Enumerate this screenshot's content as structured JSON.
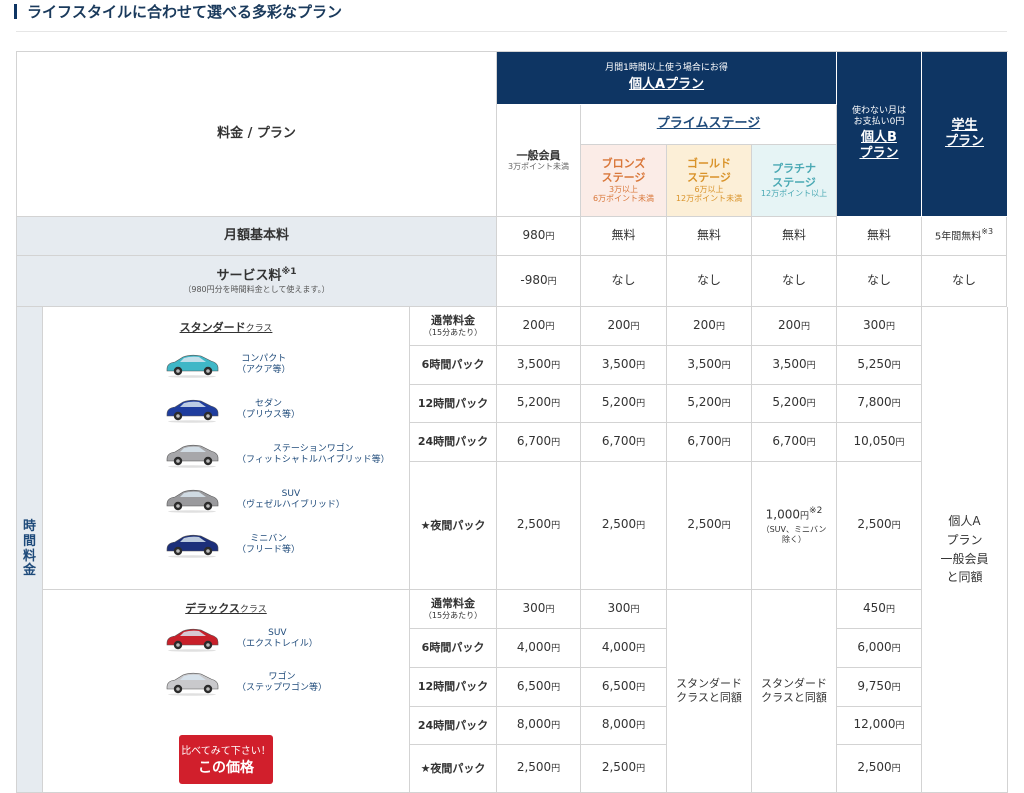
{
  "section": {
    "title": "ライフスタイルに合わせて選べる多彩なプラン"
  },
  "header": {
    "corner_label": "料金 / プラン",
    "planA_note": "月間1時間以上使う場合にお得",
    "planA_name": "個人Aプラン",
    "prime_stage": "プライムステージ",
    "general_member": "一般会員",
    "general_member_sub": "3万ポイント未満",
    "bronze": "ブロンズ\nステージ",
    "bronze_sub": "3万以上\n6万ポイント未満",
    "gold": "ゴールド\nステージ",
    "gold_sub": "6万以上\n12万ポイント未満",
    "platinum": "プラチナ\nステージ",
    "platinum_sub": "12万ポイント以上",
    "planB_note": "使わない月は\nお支払い0円",
    "planB_name": "個人B\nプラン",
    "student_name": "学生\nプラン"
  },
  "monthly": {
    "label": "月額基本料",
    "values": [
      "980",
      "無料",
      "無料",
      "無料",
      "無料",
      "5年間無料"
    ],
    "value_units": [
      "円",
      "",
      "",
      "",
      "",
      ""
    ],
    "student_note": "※3"
  },
  "service": {
    "label": "サービス料",
    "label_note": "※1",
    "sub": "（980円分を時間料金として使えます。）",
    "values": [
      "-980",
      "なし",
      "なし",
      "なし",
      "なし",
      "なし"
    ],
    "value_units": [
      "円",
      "",
      "",
      "",
      "",
      ""
    ]
  },
  "time_fee": {
    "label": "時\n間\n料\n金"
  },
  "yen": "円",
  "standard": {
    "class_name": "スタンダード",
    "class_suffix": "クラス",
    "cars": [
      {
        "name": "コンパクト",
        "example": "（アクア等）",
        "color": "#3fb7c7"
      },
      {
        "name": "セダン",
        "example": "（プリウス等）",
        "color": "#1f3d9e"
      },
      {
        "name": "ステーションワゴン",
        "example": "（フィットシャトルハイブリッド等）",
        "color": "#a7a7aa"
      },
      {
        "name": "SUV",
        "example": "（ヴェゼルハイブリッド）",
        "color": "#9a9a9d"
      },
      {
        "name": "ミニバン",
        "example": "（フリード等）",
        "color": "#1c2f7a"
      }
    ],
    "rows": [
      {
        "label": "通常料金",
        "sub": "（15分あたり）",
        "values": [
          "200",
          "200",
          "200",
          "200",
          "300"
        ]
      },
      {
        "label": "6時間パック",
        "values": [
          "3,500",
          "3,500",
          "3,500",
          "3,500",
          "5,250"
        ]
      },
      {
        "label": "12時間パック",
        "values": [
          "5,200",
          "5,200",
          "5,200",
          "5,200",
          "7,800"
        ]
      },
      {
        "label": "24時間パック",
        "values": [
          "6,700",
          "6,700",
          "6,700",
          "6,700",
          "10,050"
        ]
      },
      {
        "label": "★夜間パック",
        "values": [
          "2,500",
          "2,500",
          "2,500",
          "1,000",
          "2,500"
        ]
      }
    ],
    "night_platinum_note": "※2",
    "night_platinum_sub": "（SUV、ミニバン\n除く）"
  },
  "deluxe": {
    "class_name": "デラックス",
    "class_suffix": "クラス",
    "cars": [
      {
        "name": "SUV",
        "example": "（エクストレイル）",
        "color": "#c8202a"
      },
      {
        "name": "ワゴン",
        "example": "（ステップワゴン等）",
        "color": "#c9c9cc"
      }
    ],
    "rows": [
      {
        "label": "通常料金",
        "sub": "（15分あたり）",
        "values": [
          "300",
          "300",
          "450"
        ]
      },
      {
        "label": "6時間パック",
        "values": [
          "4,000",
          "4,000",
          "6,000"
        ]
      },
      {
        "label": "12時間パック",
        "values": [
          "6,500",
          "6,500",
          "9,750"
        ]
      },
      {
        "label": "24時間パック",
        "values": [
          "8,000",
          "8,000",
          "12,000"
        ]
      },
      {
        "label": "★夜間パック",
        "values": [
          "2,500",
          "2,500",
          "2,500"
        ]
      }
    ],
    "same_as_standard": "スタンダード\nクラスと同額",
    "cta_line1": "比べてみて下さい！",
    "cta_line2": "この価格"
  },
  "student_time_fee": "個人A\nプラン\n一般会員\nと同額"
}
